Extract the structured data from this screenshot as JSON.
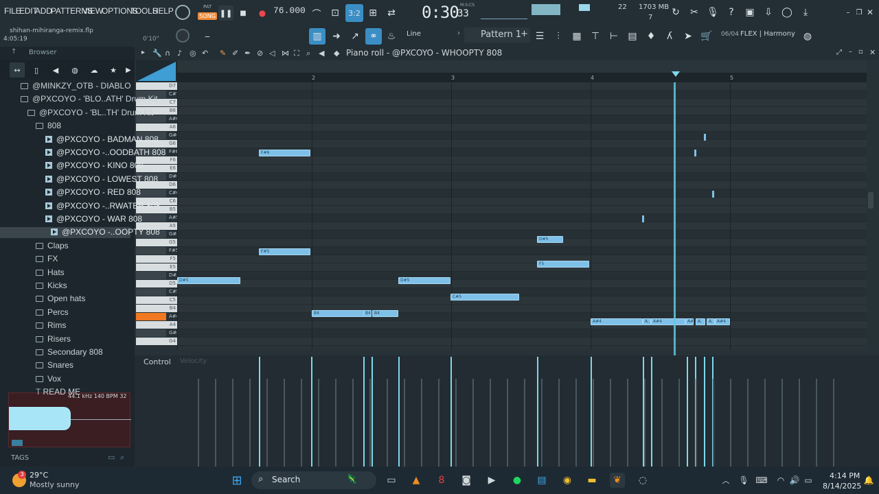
{
  "menu": [
    "FILE",
    "EDIT",
    "ADD",
    "PATTERNS",
    "VIEW",
    "OPTIONS",
    "TOOLS",
    "HELP"
  ],
  "transport": {
    "pat_label": "PAT",
    "song_label": "SONG",
    "tempo": "76.000",
    "time_main": "0:30",
    "time_sub": "33",
    "time_unit": "M:S:CS",
    "cpu": "22",
    "memory": "1703 MB",
    "voices": "7"
  },
  "project": {
    "file": "shihan-mihiranga-remix.flp",
    "length": "4:05:19",
    "hint": "0'10\""
  },
  "toolbar2": {
    "snap": "Line",
    "pattern": "Pattern 1",
    "plugin_info": "06/04",
    "plugin_name": "FLEX | Harmony"
  },
  "browser": {
    "title": "Browser",
    "items": [
      {
        "label": "@MINKZY_OTB - DIABLO",
        "type": "folder"
      },
      {
        "label": "@PXCOYO - 'BLO..ATH' Drum Kit",
        "type": "folder"
      },
      {
        "label": "@PXCOYO - 'BL..TH' Drum Kit",
        "type": "folder"
      },
      {
        "label": "808",
        "type": "folder"
      },
      {
        "label": "@PXCOYO - BADMAN 808",
        "type": "file"
      },
      {
        "label": "@PXCOYO -..OODBATH 808",
        "type": "file"
      },
      {
        "label": "@PXCOYO - KINO 808",
        "type": "file"
      },
      {
        "label": "@PXCOYO - LOWEST 808",
        "type": "file"
      },
      {
        "label": "@PXCOYO - RED 808",
        "type": "file"
      },
      {
        "label": "@PXCOYO -..RWATER 808",
        "type": "file"
      },
      {
        "label": "@PXCOYO - WAR 808",
        "type": "file"
      },
      {
        "label": "@PXCOYO -..OOPTY 808",
        "type": "file"
      },
      {
        "label": "Claps",
        "type": "folder"
      },
      {
        "label": "FX",
        "type": "folder"
      },
      {
        "label": "Hats",
        "type": "folder"
      },
      {
        "label": "Kicks",
        "type": "folder"
      },
      {
        "label": "Open hats",
        "type": "folder"
      },
      {
        "label": "Percs",
        "type": "folder"
      },
      {
        "label": "Rims",
        "type": "folder"
      },
      {
        "label": "Risers",
        "type": "folder"
      },
      {
        "label": "Secondary 808",
        "type": "folder"
      },
      {
        "label": "Snares",
        "type": "folder"
      },
      {
        "label": "Vox",
        "type": "folder"
      },
      {
        "label": "READ ME",
        "type": "text"
      }
    ],
    "sample_info": "44.1 kHz 140 BPM 32",
    "tags_label": "TAGS"
  },
  "piano_roll": {
    "title": "Piano roll - @PXCOYO - WHOOPTY 808",
    "bars": [
      "2",
      "3",
      "4",
      "5"
    ],
    "keys": [
      "D7",
      "C#7",
      "C7",
      "B6",
      "A#6",
      "A6",
      "G#6",
      "G6",
      "F#6",
      "F6",
      "E6",
      "D#6",
      "D6",
      "C#6",
      "C6",
      "B5",
      "A#5",
      "A5",
      "G#5",
      "G5",
      "F#5",
      "F5",
      "E5",
      "D#5",
      "D5",
      "C#5",
      "C5",
      "B4",
      "A#4",
      "A4",
      "G#4",
      "G4"
    ],
    "control_label": "Control",
    "control_param": "Velocity",
    "notes": [
      {
        "label": "F#6"
      },
      {
        "label": "F#5"
      },
      {
        "label": "D#5"
      },
      {
        "label": "D#5"
      },
      {
        "label": "G#5"
      },
      {
        "label": "F5"
      },
      {
        "label": "C#5"
      },
      {
        "label": "B4"
      },
      {
        "label": "B4"
      },
      {
        "label": "B4"
      },
      {
        "label": "A#4"
      },
      {
        "label": "A.."
      },
      {
        "label": "A#4"
      },
      {
        "label": "A#"
      },
      {
        "label": "A."
      },
      {
        "label": "A."
      },
      {
        "label": "A#4"
      }
    ]
  },
  "taskbar": {
    "weather_temp": "29°C",
    "weather_desc": "Mostly sunny",
    "weather_badge": "3",
    "search": "Search",
    "time": "4:14 PM",
    "date": "8/14/2025"
  }
}
